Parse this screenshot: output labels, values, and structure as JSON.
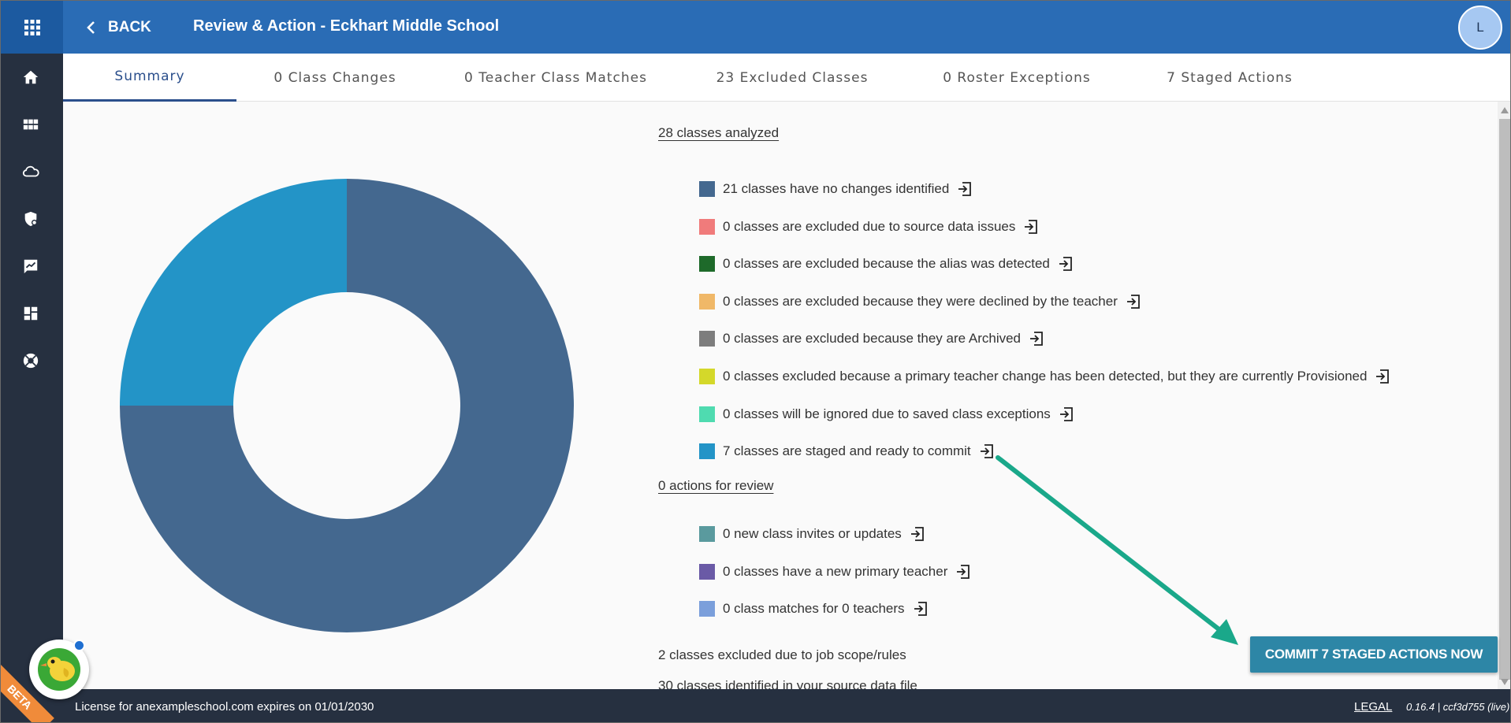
{
  "header": {
    "back_label": "BACK",
    "title": "Review & Action - Eckhart Middle School",
    "avatar_initial": "L"
  },
  "sidebar": {
    "items": [
      {
        "icon": "home-icon"
      },
      {
        "icon": "grid-icon"
      },
      {
        "icon": "cloud-icon"
      },
      {
        "icon": "shield-settings-icon"
      },
      {
        "icon": "report-icon"
      },
      {
        "icon": "dashboard-icon"
      },
      {
        "icon": "help-icon"
      }
    ]
  },
  "tabs": [
    {
      "label": "Summary",
      "active": true
    },
    {
      "label": "0 Class Changes"
    },
    {
      "label": "0 Teacher Class Matches"
    },
    {
      "label": "23 Excluded Classes"
    },
    {
      "label": "0 Roster Exceptions"
    },
    {
      "label": "7 Staged Actions"
    }
  ],
  "summary": {
    "analyzed_heading": "28 classes analyzed",
    "legend": [
      {
        "text": "21 classes have no changes identified",
        "color": "#44688f"
      },
      {
        "text": "0 classes are excluded due to source data issues",
        "color": "#f07b7b"
      },
      {
        "text": "0 classes are excluded because the alias was detected",
        "color": "#1e6a2a"
      },
      {
        "text": "0 classes are excluded because they were declined by the teacher",
        "color": "#f0b868"
      },
      {
        "text": "0 classes are excluded because they are Archived",
        "color": "#7d7d7d"
      },
      {
        "text": "0 classes excluded because a primary teacher change has been detected, but they are currently Provisioned",
        "color": "#d4d82a"
      },
      {
        "text": "0 classes will be ignored due to saved class exceptions",
        "color": "#4fdbb0"
      },
      {
        "text": "7 classes are staged and ready to commit",
        "color": "#2394c7"
      }
    ],
    "actions_heading": "0 actions for review",
    "actions": [
      {
        "text": "0 new class invites or updates",
        "color": "#5a9a9e"
      },
      {
        "text": "0 classes have a new primary teacher",
        "color": "#6a5aa6"
      },
      {
        "text": "0 class matches for 0 teachers",
        "color": "#7b9fdb"
      }
    ],
    "note_scope": "2 classes excluded due to job scope/rules",
    "note_source": "30 classes identified in your source data file"
  },
  "chart_data": {
    "type": "pie",
    "donut": true,
    "categories": [
      "no changes identified",
      "staged and ready to commit"
    ],
    "values": [
      21,
      7
    ],
    "colors": [
      "#44688f",
      "#2394c7"
    ]
  },
  "commit_button": "COMMIT 7 STAGED ACTIONS NOW",
  "footer": {
    "license": "License for anexampleschool.com expires on 01/01/2030",
    "legal": "LEGAL",
    "version": "0.16.4 | ccf3d755 (live)"
  },
  "beta_label": "BETA",
  "annotation_arrow_color": "#1aa88a"
}
